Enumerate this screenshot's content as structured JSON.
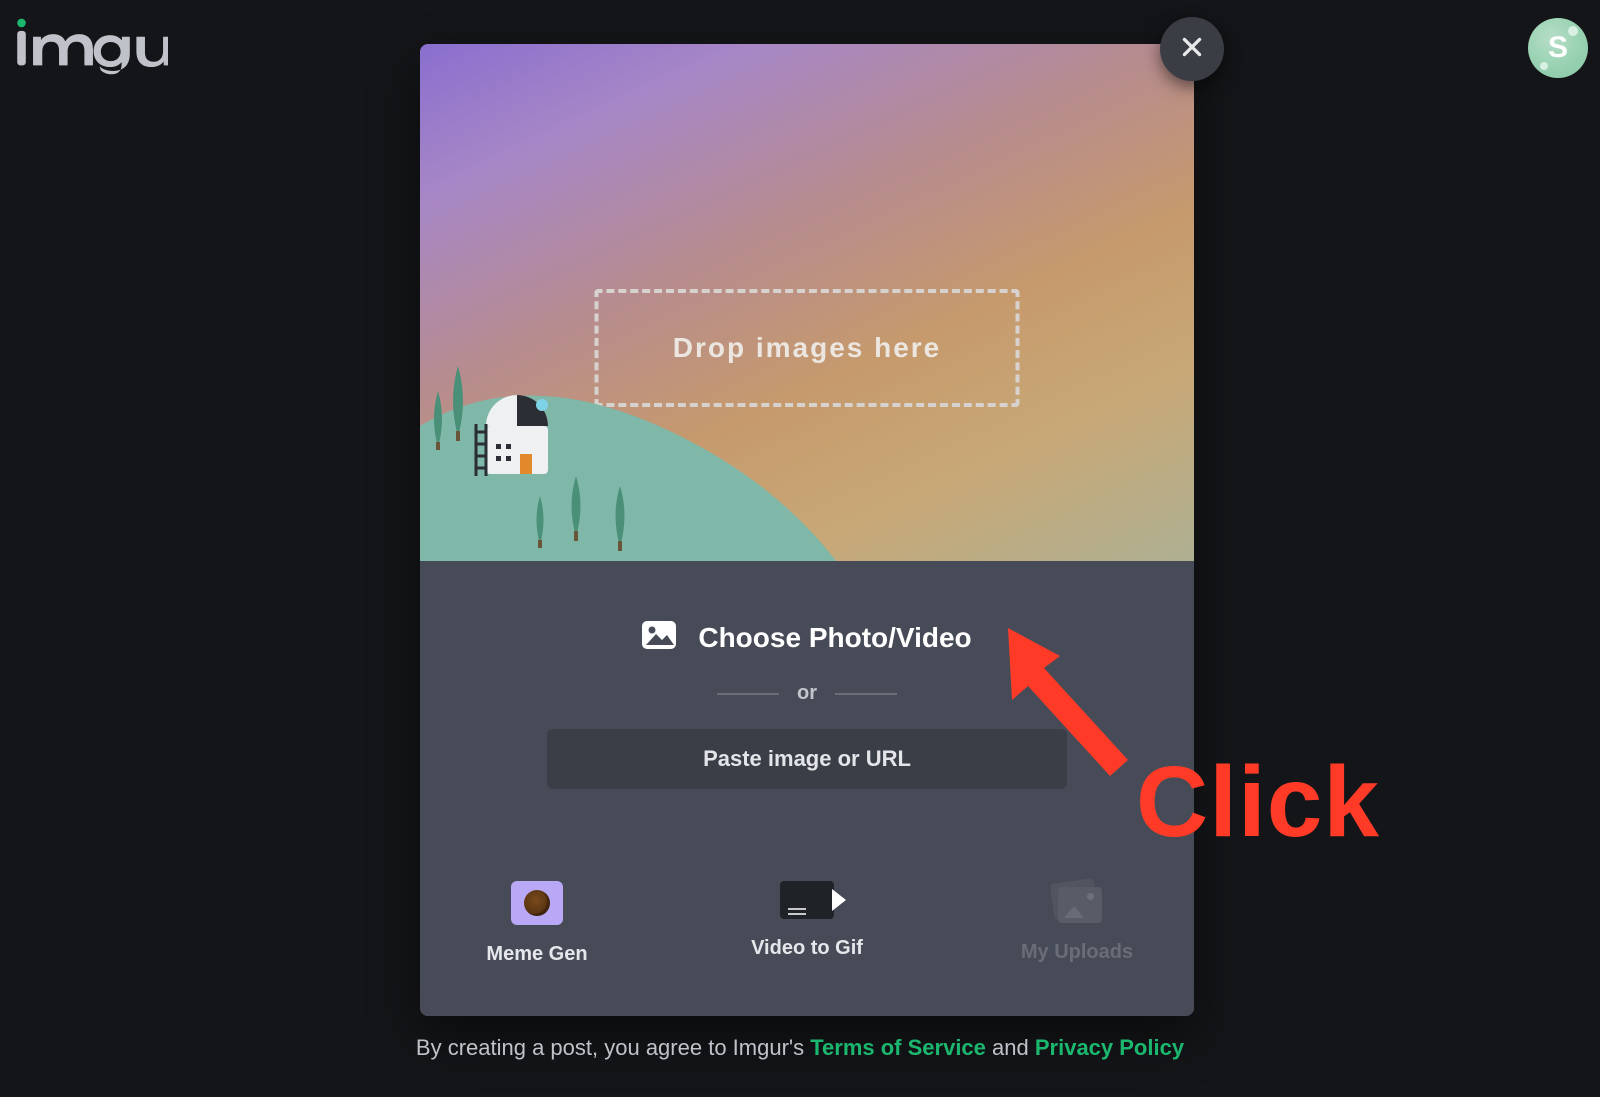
{
  "header": {
    "avatar_initial": "S"
  },
  "modal": {
    "drop_label": "Drop images here",
    "choose_label": "Choose Photo/Video",
    "or_label": "or",
    "url_placeholder": "Paste image or URL",
    "tools": {
      "meme": "Meme Gen",
      "video": "Video to Gif",
      "uploads": "My Uploads"
    }
  },
  "annotation": {
    "text": "Click"
  },
  "footer": {
    "prefix": "By creating a post, you agree to Imgur's ",
    "terms": "Terms of Service",
    "and": " and ",
    "privacy": "Privacy Policy"
  },
  "colors": {
    "accent_green": "#1bb76e",
    "annotation_red": "#ff3b28"
  }
}
